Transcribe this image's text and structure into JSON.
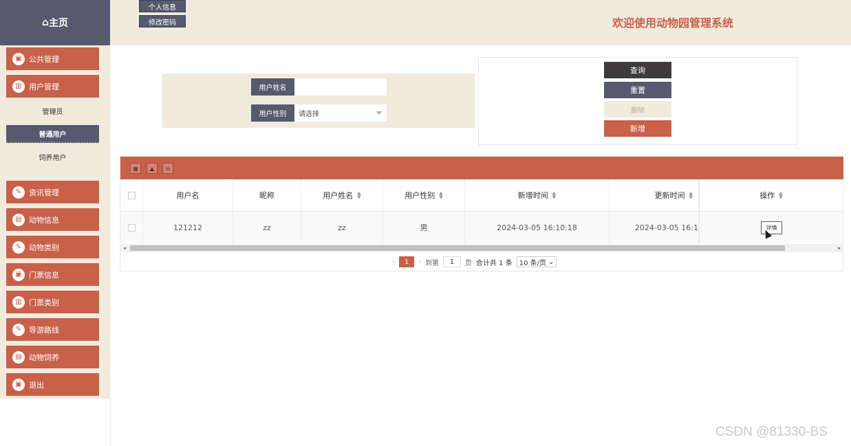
{
  "brand": {
    "home_icon": "⌂",
    "home_label": "主页"
  },
  "header": {
    "profile_label": "个人信息",
    "password_label": "修改密码",
    "welcome": "欢迎使用动物园管理系统"
  },
  "sidebar": {
    "public": "公共管理",
    "user": "用户管理",
    "sub_admin": "管理员",
    "sub_normal": "普通用户",
    "sub_keeper": "饲养用户",
    "news": "资讯管理",
    "animal_info": "动物信息",
    "animal_type": "动物类别",
    "ticket_info": "门票信息",
    "ticket_type": "门票类别",
    "tour_route": "导游路线",
    "animal_feed": "动物饲养",
    "logout": "退出"
  },
  "search": {
    "name_label": "用户姓名",
    "name_value": "",
    "gender_label": "用户性别",
    "gender_placeholder": "请选择"
  },
  "actions": {
    "query": "查询",
    "reset": "重置",
    "delete": "删除",
    "add": "新增"
  },
  "table": {
    "headers": {
      "username": "用户名",
      "nickname": "昵称",
      "realname": "用户姓名",
      "gender": "用户性别",
      "created": "新增时间",
      "updated": "更新时间",
      "ops": "操作"
    },
    "row": {
      "username": "121212",
      "nickname": "zz",
      "realname": "zz",
      "gender": "男",
      "created": "2024-03-05 16:10:18",
      "updated": "2024-03-05 16:1",
      "detail": "详情"
    }
  },
  "pager": {
    "current": "1",
    "goto_label": "到第",
    "goto_value": "1",
    "page_unit": "页",
    "total": "合计共 1 条",
    "per_page": "10 条/页"
  },
  "watermark": "CSDN @81330-BS",
  "colors": {
    "accent": "#c8604a",
    "slate": "#555a6e",
    "cream": "#f1ebdd",
    "dark": "#3d3a40"
  }
}
